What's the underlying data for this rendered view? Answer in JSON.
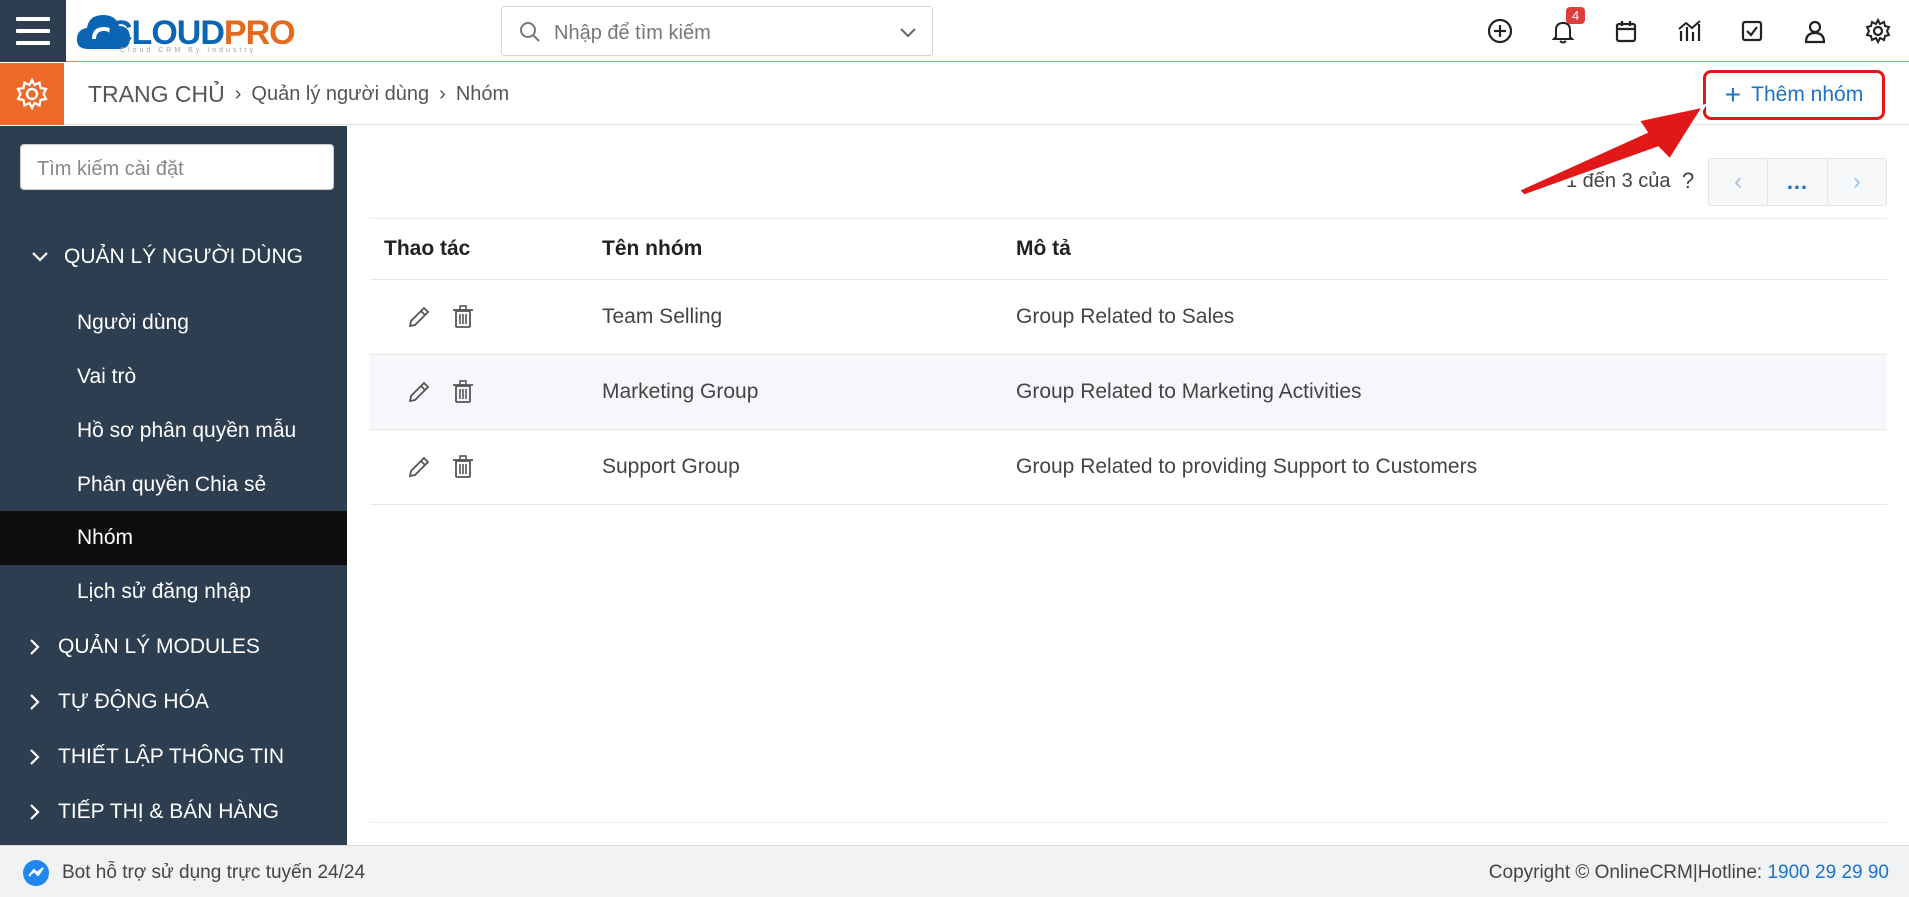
{
  "header": {
    "logo_text": "CLOUDPRO",
    "logo_tagline": "Cloud CRM By Industry",
    "search_placeholder": "Nhập để tìm kiếm",
    "notification_count": "4"
  },
  "breadcrumb": {
    "home": "TRANG CHỦ",
    "level1": "Quản lý người dùng",
    "level2": "Nhóm"
  },
  "add_button_label": "Thêm nhóm",
  "sidebar": {
    "search_placeholder": "Tìm kiếm cài đặt",
    "expanded_section": "QUẢN LÝ NGƯỜI DÙNG",
    "items": [
      {
        "label": "Người dùng"
      },
      {
        "label": "Vai trò"
      },
      {
        "label": "Hồ sơ phân quyền mẫu"
      },
      {
        "label": "Phân quyền Chia sẻ"
      },
      {
        "label": "Nhóm"
      },
      {
        "label": "Lịch sử đăng nhập"
      }
    ],
    "collapsed_sections": [
      {
        "label": "QUẢN LÝ MODULES"
      },
      {
        "label": "TỰ ĐỘNG HÓA"
      },
      {
        "label": "THIẾT LẬP THÔNG TIN"
      },
      {
        "label": "TIẾP THỊ & BÁN HÀNG"
      }
    ]
  },
  "pagination": {
    "text": "1 đến 3 của",
    "help": "?",
    "more": "..."
  },
  "table": {
    "headers": [
      "Thao tác",
      "Tên nhóm",
      "Mô tả"
    ],
    "rows": [
      {
        "name": "Team Selling",
        "description": "Group Related to Sales"
      },
      {
        "name": "Marketing Group",
        "description": "Group Related to Marketing Activities"
      },
      {
        "name": "Support Group",
        "description": "Group Related to providing Support to Customers"
      }
    ]
  },
  "footer": {
    "bot_text": "Bot hỗ trợ sử dụng trực tuyến 24/24",
    "copyright": "Copyright © OnlineCRM|Hotline: ",
    "hotline": "1900 29 29 90"
  },
  "colors": {
    "sidebar_bg": "#2d3e50",
    "accent_orange": "#ef6a2a",
    "link_blue": "#1a73c6",
    "highlight_red": "#e01818"
  }
}
